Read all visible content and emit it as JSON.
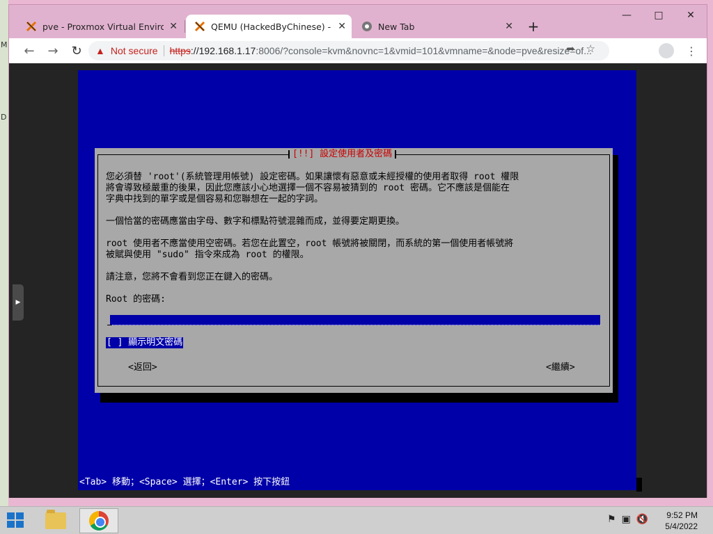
{
  "desktop": {
    "left_glyphs": [
      "M",
      "D"
    ]
  },
  "browser": {
    "tabs": [
      {
        "label": "pve - Proxmox Virtual Environme",
        "icon": "proxmox-icon",
        "active": false
      },
      {
        "label": "QEMU (HackedByChinese) - noVN",
        "icon": "proxmox-icon",
        "active": true
      },
      {
        "label": "New Tab",
        "icon": "chrome-icon",
        "active": false
      }
    ],
    "new_tab_label": "+",
    "address": {
      "security_label": "Not secure",
      "scheme": "https",
      "host": "://192.168.1.17",
      "rest": ":8006/?console=kvm&novnc=1&vmid=101&vmname=&node=pve&resize=of..."
    }
  },
  "installer": {
    "dialog_title": "[!!] 設定使用者及密碼",
    "paragraphs": [
      "您必須替 'root'(系統管理用帳號) 設定密碼。如果讓懷有惡意或未經授權的使用者取得 root 權限\n將會導致極嚴重的後果，因此您應該小心地選擇一個不容易被猜到的 root 密碼。它不應該是個能在\n字典中找到的單字或是個容易和您聯想在一起的字詞。",
      "一個恰當的密碼應當由字母、數字和標點符號混雜而成，並得要定期更換。",
      "root 使用者不應當使用空密碼。若您在此置空，root 帳號將被關閉，而系統的第一個使用者帳號將\n被賦與使用 \"sudo\" 指令來成為 root 的權限。",
      "請注意，您將不會看到您正在鍵入的密碼。"
    ],
    "password_label": "Root 的密碼:",
    "password_value": "",
    "show_password_label": "[ ] 顯示明文密碼",
    "back_button": "<返回>",
    "continue_button": "<繼續>",
    "status_line": "<Tab> 移動；<Space> 選擇；<Enter> 按下按鈕"
  },
  "taskbar": {
    "time": "9:52 PM",
    "date": "5/4/2022"
  },
  "colors": {
    "installer_bg": "#0000a8",
    "dialog_bg": "#a8a8a8",
    "title_red": "#c80000",
    "taskbar": "#cfcfcf",
    "browser_frame": "#e1b2cf"
  }
}
